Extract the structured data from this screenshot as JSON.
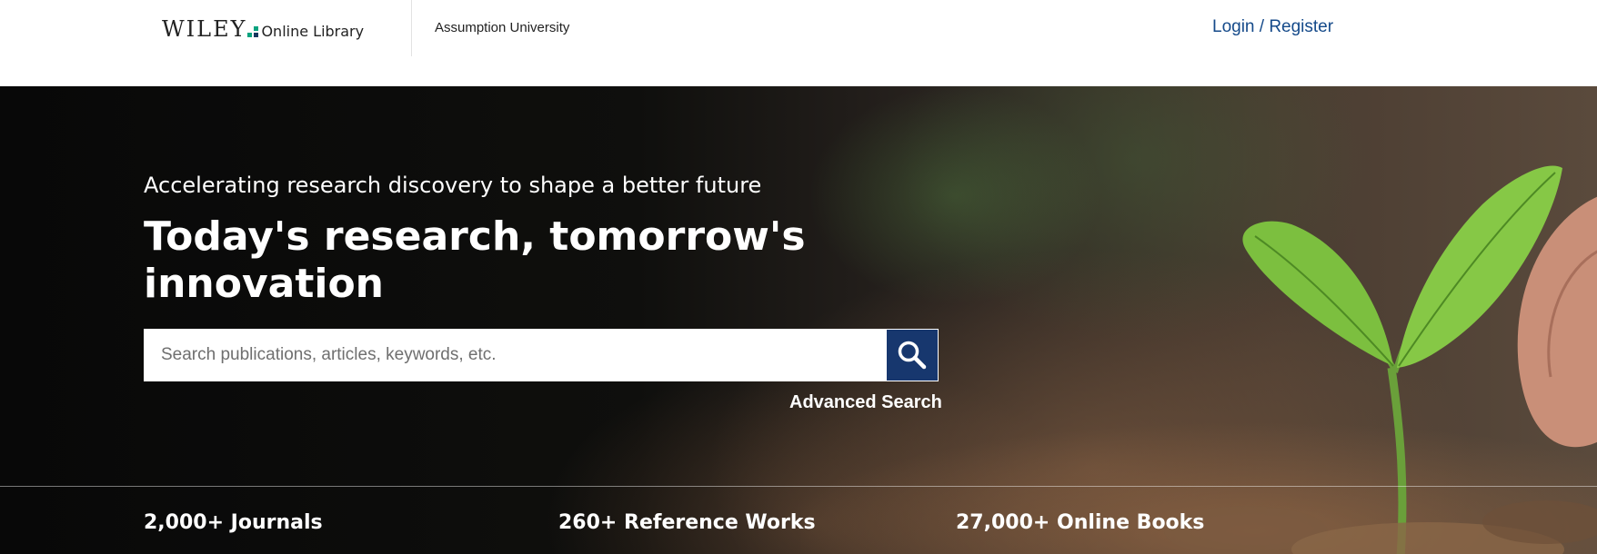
{
  "header": {
    "logo_wordmark": "WILEY",
    "logo_product": "Online Library",
    "institution": "Assumption University",
    "login_label": "Login / Register"
  },
  "hero": {
    "tagline": "Accelerating research discovery to shape a better future",
    "headline": "Today's research, tomorrow's innovation"
  },
  "search": {
    "placeholder": "Search publications, articles, keywords, etc.",
    "value": "",
    "button_icon": "search-icon",
    "advanced_label": "Advanced Search"
  },
  "stats": [
    {
      "label": "2,000+ Journals"
    },
    {
      "label": "260+ Reference Works"
    },
    {
      "label": "27,000+ Online Books"
    }
  ],
  "colors": {
    "brand_blue": "#17376e",
    "link_blue": "#154a8a",
    "logo_green": "#0aa37f"
  }
}
